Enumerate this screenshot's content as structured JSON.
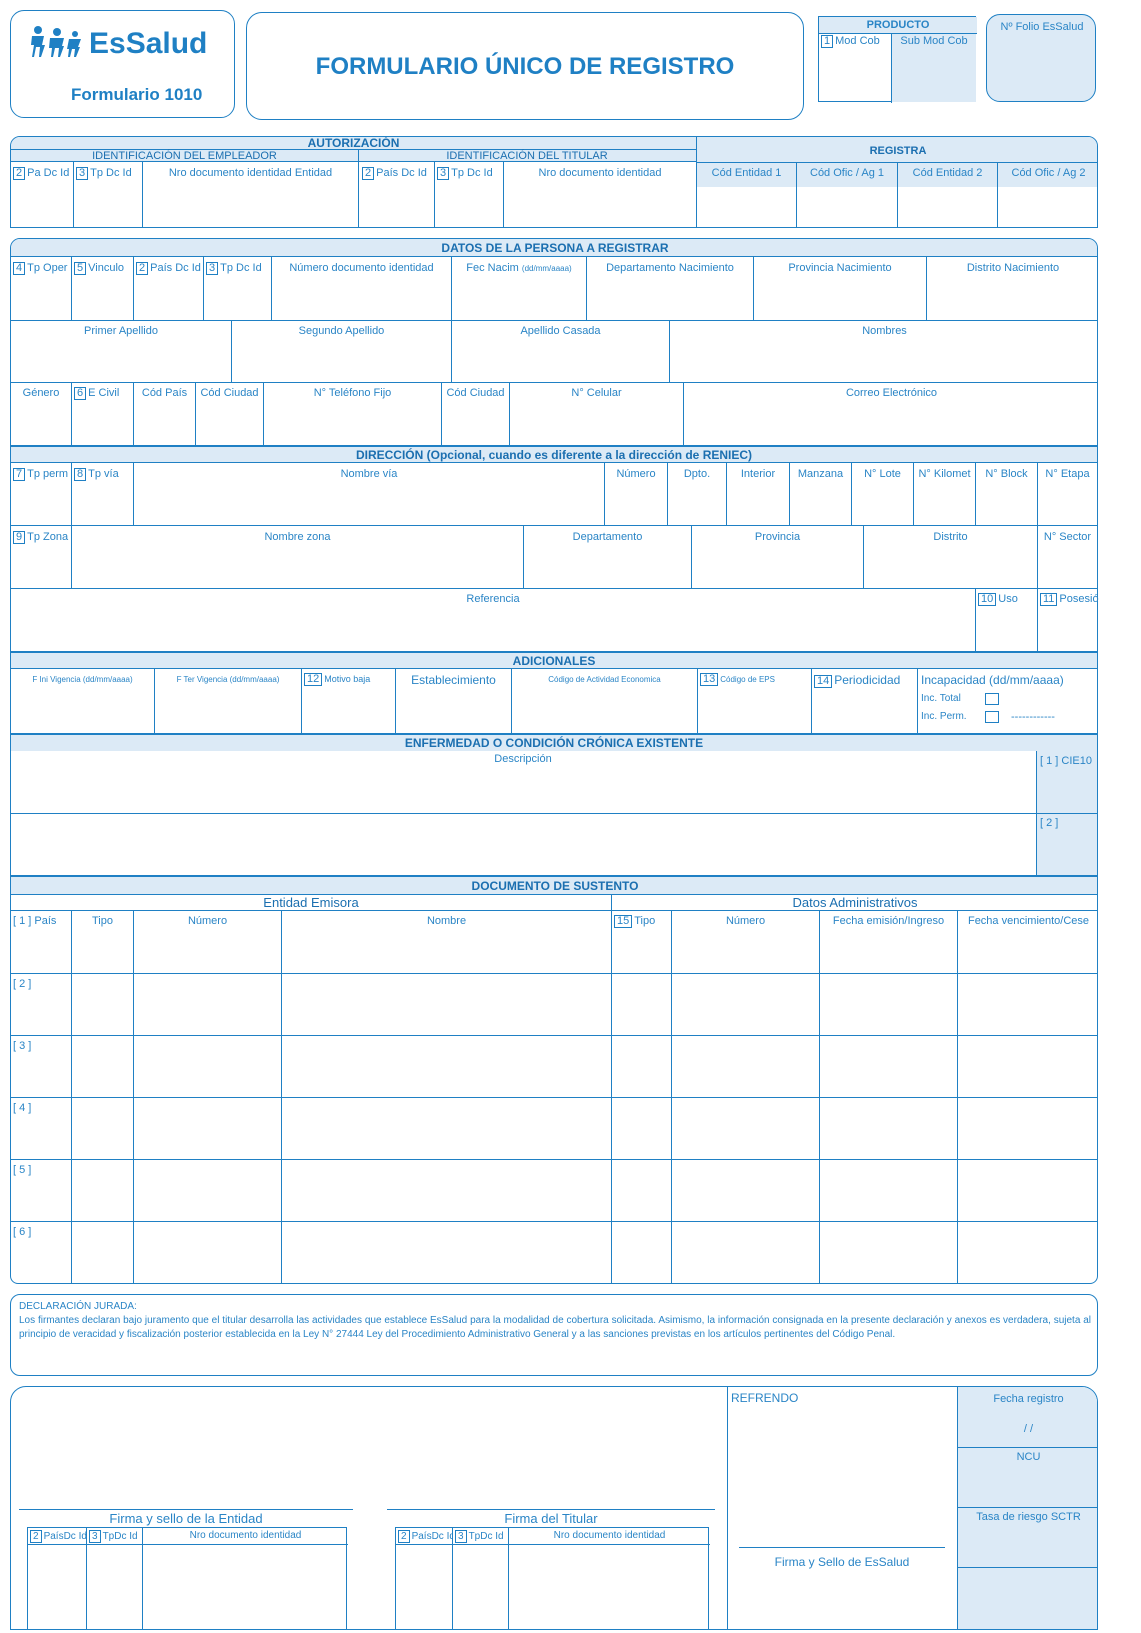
{
  "header": {
    "brand": "EsSalud",
    "form_code": "Formulario 1010",
    "title": "FORMULARIO ÚNICO DE REGISTRO",
    "producto": "PRODUCTO",
    "producto_num": "1",
    "mod_cob": "Mod Cob",
    "sub_mod_cob": "Sub Mod Cob",
    "folio": "Nº Folio EsSalud"
  },
  "autorizacion": {
    "title": "AUTORIZACIÓN",
    "empleador": "IDENTIFICACIÓN DEL EMPLEADOR",
    "titular": "IDENTIFICACIÓN DEL TITULAR",
    "c1": "Pa Dc Id",
    "c1n": "2",
    "c2": "Tp Dc Id",
    "c2n": "3",
    "c3": "Nro documento identidad Entidad",
    "c4": "País Dc Id",
    "c4n": "2",
    "c5": "Tp Dc Id",
    "c5n": "3",
    "c6": "Nro documento identidad",
    "registra": "REGISTRA",
    "r1": "Cód Entidad 1",
    "r2": "Cód Ofic / Ag 1",
    "r3": "Cód Entidad 2",
    "r4": "Cód Ofic / Ag 2"
  },
  "persona": {
    "title": "DATOS DE LA PERSONA A REGISTRAR",
    "tp_oper": "Tp Oper",
    "tp_oper_n": "4",
    "vinculo": "Vinculo",
    "vinculo_n": "5",
    "pais": "País Dc Id",
    "pais_n": "2",
    "tpdc": "Tp Dc Id",
    "tpdc_n": "3",
    "numdoc": "Número documento identidad",
    "fec": "Fec Nacim",
    "fec_fmt": "(dd/mm/aaaa)",
    "dep": "Departamento Nacimiento",
    "prov": "Provincia Nacimiento",
    "dist": "Distrito Nacimiento",
    "ap1": "Primer Apellido",
    "ap2": "Segundo Apellido",
    "apc": "Apellido Casada",
    "nom": "Nombres",
    "genero": "Género",
    "ecivil": "E Civil",
    "ecivil_n": "6",
    "codpais": "Cód País",
    "codciudad": "Cód Ciudad",
    "telf": "N° Teléfono Fijo",
    "codciudad2": "Cód Ciudad",
    "cel": "N° Celular",
    "correo": "Correo Electrónico"
  },
  "direccion": {
    "title": "DIRECCIÓN  (Opcional, cuando es diferente a la dirección de RENIEC)",
    "tpperm": "Tp perm",
    "tpperm_n": "7",
    "tpvia": "Tp vía",
    "tpvia_n": "8",
    "nomvia": "Nombre vía",
    "numero": "Número",
    "dpto": "Dpto.",
    "interior": "Interior",
    "manzana": "Manzana",
    "lote": "N° Lote",
    "kilomet": "N° Kilomet",
    "block": "N° Block",
    "etapa": "N° Etapa",
    "tpzona": "Tp Zona",
    "tpzona_n": "9",
    "nomzona": "Nombre zona",
    "departamento": "Departamento",
    "provincia": "Provincia",
    "distrito": "Distrito",
    "sector": "N° Sector",
    "referencia": "Referencia",
    "uso": "Uso",
    "uso_n": "10",
    "posesion": "Posesión",
    "posesion_n": "11"
  },
  "adicionales": {
    "title": "ADICIONALES",
    "fini": "F Ini Vigencia (dd/mm/aaaa)",
    "fter": "F Ter Vigencia (dd/mm/aaaa)",
    "motivo": "Motivo baja",
    "motivo_n": "12",
    "estab": "Establecimiento",
    "ciiu": "Código de Actividad Economica",
    "eps": "Código de EPS",
    "eps_n": "13",
    "period": "Periodicidad",
    "period_n": "14",
    "incap": "Incapacidad   (dd/mm/aaaa)",
    "inc_total": "Inc. Total",
    "inc_perm": "Inc. Perm.",
    "dashes": "------------"
  },
  "enfermedad": {
    "title": "ENFERMEDAD O CONDICIÓN CRÓNICA EXISTENTE",
    "desc": "Descripción",
    "cie1": "[ 1 ] CIE10",
    "cie2": "[ 2 ]"
  },
  "sustento": {
    "title": "DOCUMENTO DE SUSTENTO",
    "entidad": "Entidad Emisora",
    "admin": "Datos Administrativos",
    "pais": "[ 1 ] País",
    "tipo": "Tipo",
    "numero": "Número",
    "nombre": "Nombre",
    "tipo2": "Tipo",
    "tipo2_n": "15",
    "numero2": "Número",
    "femision": "Fecha emisión/Ingreso",
    "fvenc": "Fecha vencimiento/Cese",
    "rows": [
      "[ 2 ]",
      "[ 3 ]",
      "[ 4 ]",
      "[ 5 ]",
      "[ 6 ]"
    ]
  },
  "declaracion": {
    "title": "DECLARACIÓN JURADA:",
    "text": "Los firmantes declaran bajo juramento que el titular  desarrolla las actividades que establece EsSalud para la modalidad de cobertura solicitada. Asimismo, la información consignada en la presente declaración y anexos es verdadera, sujeta al principio de veracidad y fiscalización posterior establecida en la Ley N° 27444 Ley del Procedimiento Administrativo General y a las sanciones previstas en los artículos pertinentes del Código Penal."
  },
  "firmas": {
    "entidad": "Firma y sello de la Entidad",
    "titular": "Firma del Titular",
    "pais": "PaísDc Id",
    "pais_n": "2",
    "tp": "TpDc Id",
    "tp_n": "3",
    "nro": "Nro documento identidad",
    "refrendo": "REFRENDO",
    "sello": "Firma y Sello de EsSalud",
    "fecha_registro": "Fecha registro",
    "slashes": "/   /",
    "ncu": "NCU",
    "tasa": "Tasa de riesgo SCTR"
  }
}
